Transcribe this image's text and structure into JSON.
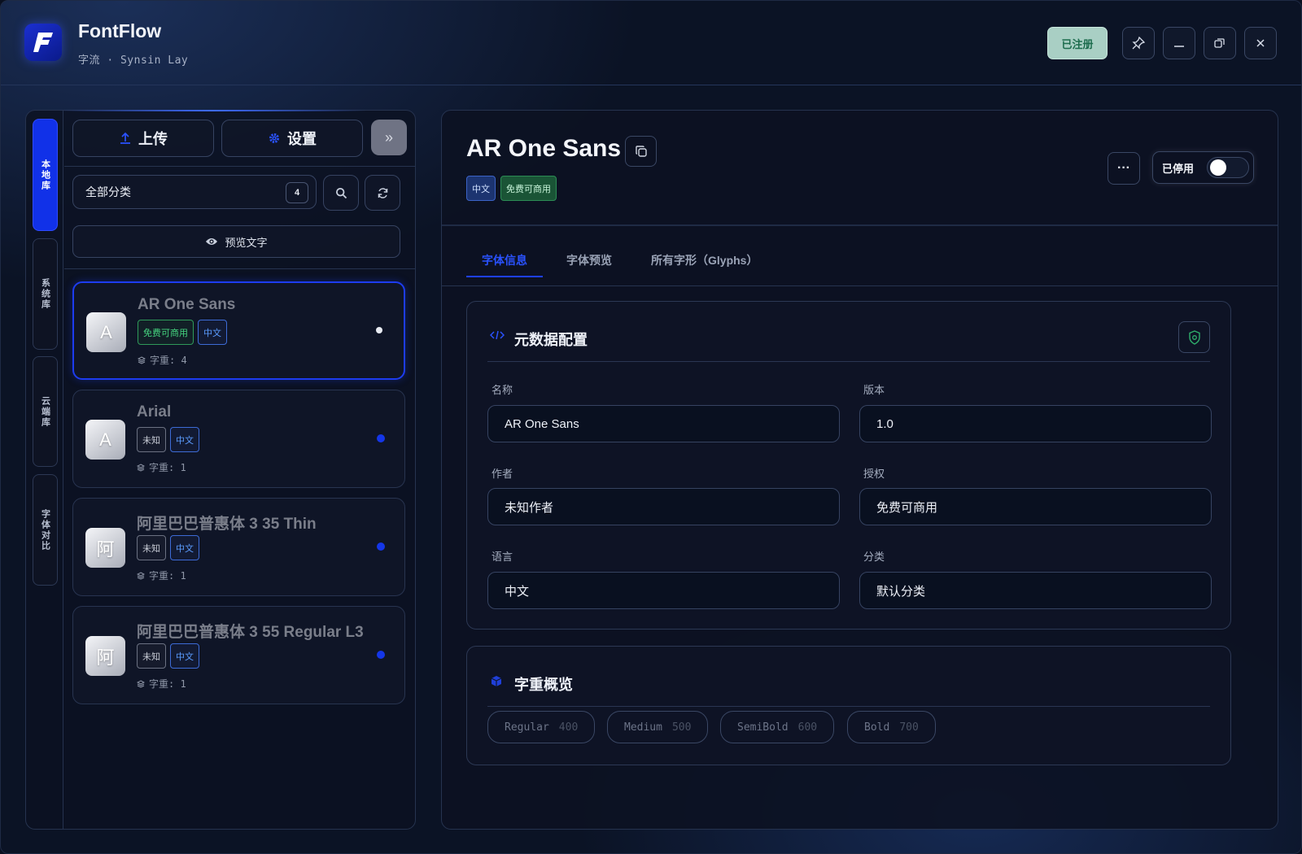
{
  "app": {
    "title": "FontFlow",
    "subtitle": "字流 · Synsin Lay",
    "registered_label": "已注册"
  },
  "sidebar_tabs": [
    "本地库",
    "系统库",
    "云端库",
    "字体对比"
  ],
  "toolbar": {
    "upload_label": "上传",
    "settings_label": "设置",
    "expand_glyph": "»",
    "category_value": "全部分类",
    "category_count": "4",
    "preview_label": "预览文字"
  },
  "font_list": [
    {
      "name": "AR One Sans",
      "avatar": "A",
      "tags": [
        {
          "text": "免费可商用",
          "color": "green"
        },
        {
          "text": "中文",
          "color": "blue"
        }
      ],
      "weights": "字重: 4",
      "active": true
    },
    {
      "name": "Arial",
      "avatar": "A",
      "tags": [
        {
          "text": "未知",
          "color": "gray"
        },
        {
          "text": "中文",
          "color": "blue"
        }
      ],
      "weights": "字重: 1",
      "active": false
    },
    {
      "name": "阿里巴巴普惠体 3 35 Thin",
      "avatar": "阿",
      "tags": [
        {
          "text": "未知",
          "color": "gray"
        },
        {
          "text": "中文",
          "color": "blue"
        }
      ],
      "weights": "字重: 1",
      "active": false
    },
    {
      "name": "阿里巴巴普惠体 3 55 Regular L3",
      "avatar": "阿",
      "tags": [
        {
          "text": "未知",
          "color": "gray"
        },
        {
          "text": "中文",
          "color": "blue"
        }
      ],
      "weights": "字重: 1",
      "active": false
    }
  ],
  "detail": {
    "title": "AR One Sans",
    "tags": [
      "中文",
      "免费可商用"
    ],
    "more_glyph": "···",
    "status_label": "已停用",
    "enabled": false,
    "tabs": [
      "字体信息",
      "字体预览",
      "所有字形（Glyphs）"
    ],
    "active_tab": 0,
    "metadata": {
      "title": "元数据配置",
      "fields": [
        {
          "label": "名称",
          "value": "AR One Sans"
        },
        {
          "label": "版本",
          "value": "1.0"
        },
        {
          "label": "作者",
          "value": "未知作者"
        },
        {
          "label": "授权",
          "value": "免费可商用"
        },
        {
          "label": "语言",
          "value": "中文"
        },
        {
          "label": "分类",
          "value": "默认分类"
        }
      ]
    },
    "weights": {
      "title": "字重概览",
      "items": [
        {
          "name": "Regular",
          "value": "400"
        },
        {
          "name": "Medium",
          "value": "500"
        },
        {
          "name": "SemiBold",
          "value": "600"
        },
        {
          "name": "Bold",
          "value": "700"
        }
      ]
    }
  },
  "colors": {
    "accent": "#1131e8",
    "tag_green": "#45d47f",
    "tag_blue": "#5b9cff"
  }
}
